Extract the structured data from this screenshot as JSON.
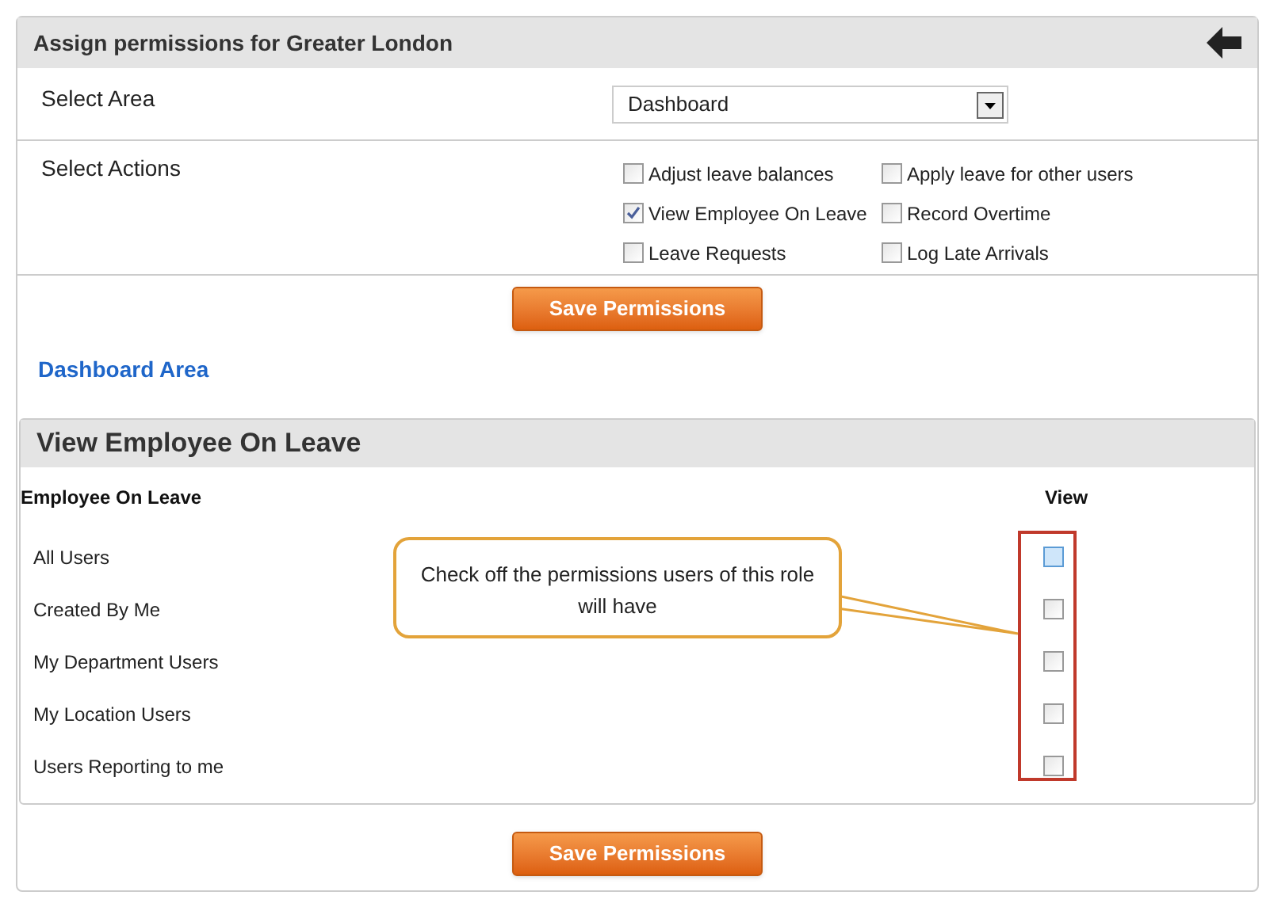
{
  "panel": {
    "title": "Assign permissions for Greater London"
  },
  "select_area": {
    "label": "Select Area",
    "value": "Dashboard"
  },
  "select_actions": {
    "label": "Select Actions",
    "options": [
      {
        "label": "Adjust leave balances",
        "checked": false
      },
      {
        "label": "Apply leave for other users",
        "checked": false
      },
      {
        "label": "View Employee On Leave",
        "checked": true
      },
      {
        "label": "Record Overtime",
        "checked": false
      },
      {
        "label": "Leave Requests",
        "checked": false
      },
      {
        "label": "Log Late Arrivals",
        "checked": false
      }
    ]
  },
  "save_button_top": "Save Permissions",
  "area_heading": "Dashboard Area",
  "section": {
    "title": "View Employee On Leave",
    "columns": [
      "Employee On Leave",
      "View"
    ],
    "rows": [
      {
        "label": "All Users",
        "checked": false,
        "highlighted": true
      },
      {
        "label": "Created By Me",
        "checked": false,
        "highlighted": false
      },
      {
        "label": "My Department Users",
        "checked": false,
        "highlighted": false
      },
      {
        "label": "My Location Users",
        "checked": false,
        "highlighted": false
      },
      {
        "label": "Users Reporting to me",
        "checked": false,
        "highlighted": false
      }
    ]
  },
  "callout": {
    "text": "Check off  the permissions users of this role will have"
  },
  "save_button_bottom": "Save Permissions"
}
